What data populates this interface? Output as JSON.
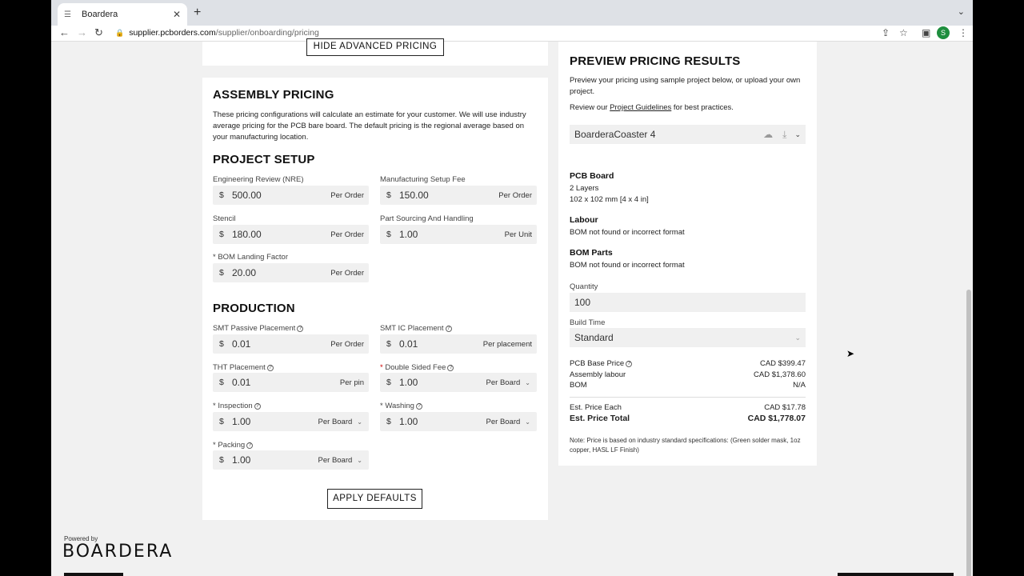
{
  "browser": {
    "tab_title": "Boardera",
    "url_host": "supplier.pcborders.com",
    "url_path": "/supplier/onboarding/pricing",
    "avatar_letter": "S"
  },
  "top_card": {
    "hide_label": "HIDE ADVANCED PRICING"
  },
  "assembly": {
    "title": "ASSEMBLY PRICING",
    "description": "These pricing configurations will calculate an estimate for your customer. We will use industry average pricing for the PCB bare board. The default pricing is the regional average based on your manufacturing location."
  },
  "project_setup": {
    "title": "PROJECT SETUP",
    "fields": [
      {
        "label": "Engineering Review (NRE)",
        "currency": "$",
        "value": "500.00",
        "unit": "Per Order"
      },
      {
        "label": "Manufacturing Setup Fee",
        "currency": "$",
        "value": "150.00",
        "unit": "Per Order"
      },
      {
        "label": "Stencil",
        "currency": "$",
        "value": "180.00",
        "unit": "Per Order"
      },
      {
        "label": "Part Sourcing And Handling",
        "currency": "$",
        "value": "1.00",
        "unit": "Per Unit"
      },
      {
        "label": "BOM Landing Factor",
        "currency": "$",
        "value": "20.00",
        "unit": "Per Order"
      }
    ]
  },
  "production": {
    "title": "PRODUCTION",
    "fields": [
      {
        "label": "SMT Passive Placement",
        "currency": "$",
        "value": "0.01",
        "unit": "Per Order"
      },
      {
        "label": "SMT IC Placement",
        "currency": "$",
        "value": "0.01",
        "unit": "Per placement"
      },
      {
        "label": "THT Placement",
        "currency": "$",
        "value": "0.01",
        "unit": "Per pin"
      },
      {
        "label": "Double Sided Fee",
        "currency": "$",
        "value": "1.00",
        "unit": "Per Board"
      },
      {
        "label": "Inspection",
        "currency": "$",
        "value": "1.00",
        "unit": "Per Board"
      },
      {
        "label": "Washing",
        "currency": "$",
        "value": "1.00",
        "unit": "Per Board"
      },
      {
        "label": "Packing",
        "currency": "$",
        "value": "1.00",
        "unit": "Per Board"
      }
    ],
    "required_marker": "*"
  },
  "apply_label": "APPLY DEFAULTS",
  "preview": {
    "title": "PREVIEW PRICING RESULTS",
    "intro": "Preview your pricing using sample project below, or upload your own project.",
    "review_prefix": "Review our ",
    "review_link": "Project Guidelines",
    "review_suffix": " for best practices.",
    "project": "BoarderaCoaster 4",
    "pcb_title": "PCB Board",
    "pcb_layers": "2 Layers",
    "pcb_size": "102 x 102 mm [4 x 4 in]",
    "labour_title": "Labour",
    "labour_msg": "BOM not found or incorrect format",
    "bom_title": "BOM Parts",
    "bom_msg": "BOM not found or incorrect format",
    "quantity_label": "Quantity",
    "quantity_value": "100",
    "build_label": "Build Time",
    "build_value": "Standard",
    "pcb_base_label": "PCB Base Price",
    "pcb_base_value": "CAD $399.47",
    "assembly_label": "Assembly labour",
    "assembly_value": "CAD $1,378.60",
    "bom_label": "BOM",
    "bom_value": "N/A",
    "each_label": "Est. Price Each",
    "each_value": "CAD $17.78",
    "total_label": "Est. Price Total",
    "total_value": "CAD $1,778.07",
    "note": "Note: Price is based on industry standard specifications: (Green solder mask, 1oz copper, HASL LF Finish)"
  },
  "footer": {
    "powered": "Powered by",
    "brand": "BOARDERA"
  }
}
